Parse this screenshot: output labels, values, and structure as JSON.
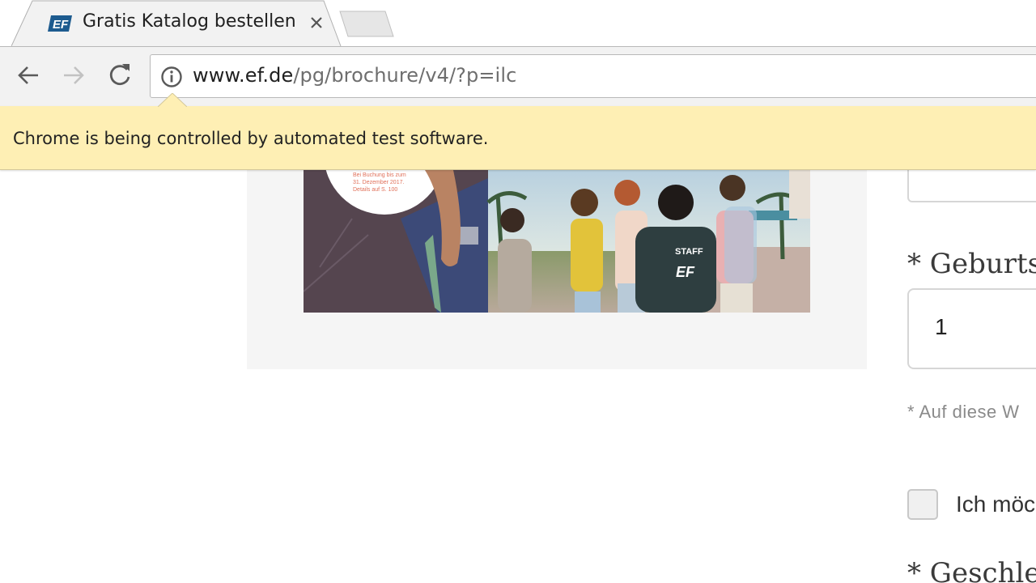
{
  "browser": {
    "tab": {
      "title": "Gratis Katalog bestellen",
      "favicon": "ef-logo-icon"
    },
    "address": {
      "host": "www.ef.de",
      "path": "/pg/brochure/v4/?p=ilc"
    }
  },
  "infobar": {
    "message": "Chrome is being controlled by automated test software."
  },
  "catalog": {
    "promo_lines": [
      "Bei Buchung bis zum",
      "31. Dezember 2017.",
      "Details auf S. 100"
    ],
    "staff_shirt": "STAFF"
  },
  "form": {
    "birth_label": "* Geburtsd",
    "birth_value": "1",
    "note": "* Auf diese W",
    "newsletter_label": "Ich möc",
    "gender_label": "* Geschlec"
  },
  "colors": {
    "infobar_bg": "#feefb4",
    "panel_bg": "#f5f5f5",
    "ef_blue": "#1d5b8f"
  }
}
